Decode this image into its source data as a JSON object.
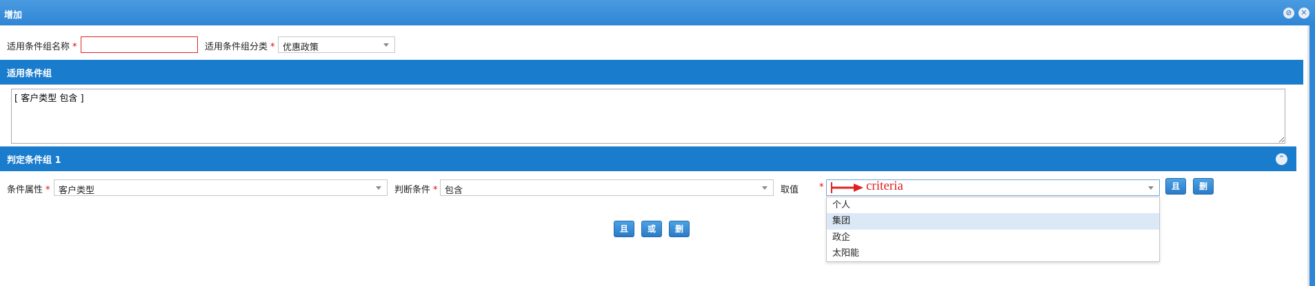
{
  "window": {
    "title": "增加"
  },
  "form": {
    "group_name_label": "适用条件组名称",
    "group_name_value": "",
    "group_category_label": "适用条件组分类",
    "group_category_value": "优惠政策",
    "required_mark": "*"
  },
  "section_applicable": {
    "title": "适用条件组",
    "condition_text": "[ 客户类型 包含 ]"
  },
  "section_judge": {
    "title": "判定条件组 1",
    "attribute_label": "条件属性",
    "attribute_value": "客户类型",
    "condition_label": "判断条件",
    "condition_value": "包含",
    "value_label": "取值",
    "value_annotation": "criteria",
    "and_button": "且",
    "delete_button": "删"
  },
  "dropdown": {
    "options": [
      "个人",
      "集团",
      "政企",
      "太阳能"
    ],
    "highlighted_index": 1
  },
  "bottom_buttons": {
    "and": "且",
    "or": "或",
    "delete": "删"
  },
  "colors": {
    "accent": "#1a7ccd",
    "titlebar": "#3a8fdb",
    "required": "#e00000",
    "annotation": "#e02020"
  },
  "icons": {
    "minimize": "minimize-icon",
    "close": "close-icon",
    "collapse": "chevron-up-icon"
  }
}
